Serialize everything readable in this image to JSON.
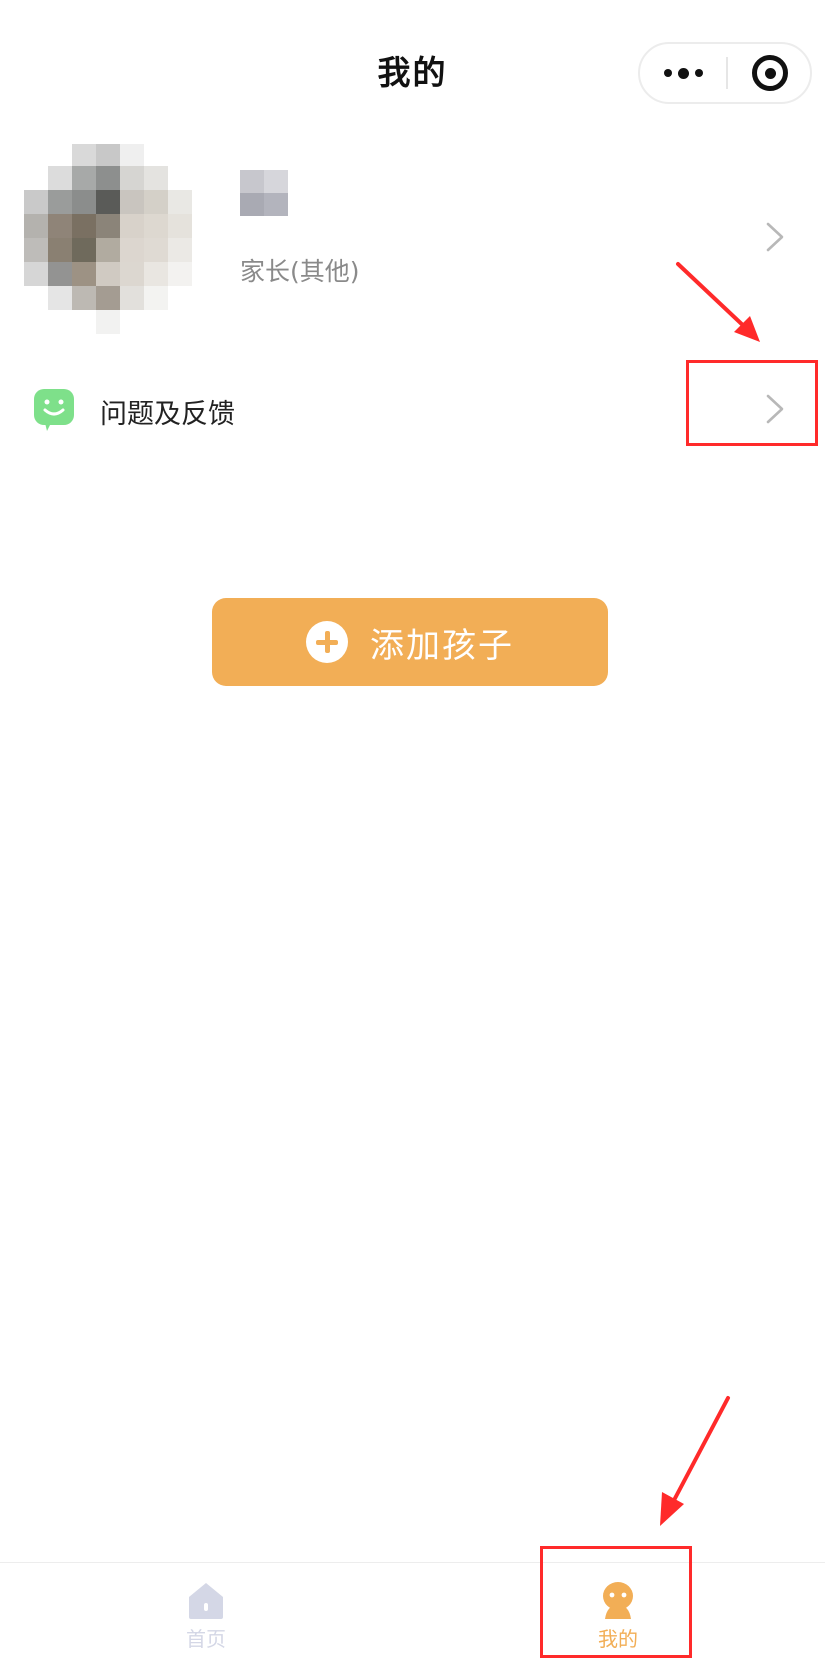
{
  "header": {
    "title": "我的"
  },
  "profile": {
    "role": "家长(其他)"
  },
  "menu": {
    "feedback_label": "问题及反馈"
  },
  "actions": {
    "add_child_label": "添加孩子"
  },
  "tabbar": {
    "items": [
      {
        "label": "首页",
        "icon": "home-icon",
        "active": false
      },
      {
        "label": "我的",
        "icon": "user-icon",
        "active": true
      }
    ]
  },
  "colors": {
    "accent": "#f2ae56",
    "feedback_icon": "#7ee08a",
    "inactive_tab": "#d4d7e6",
    "annotation": "#ff2a2a"
  }
}
